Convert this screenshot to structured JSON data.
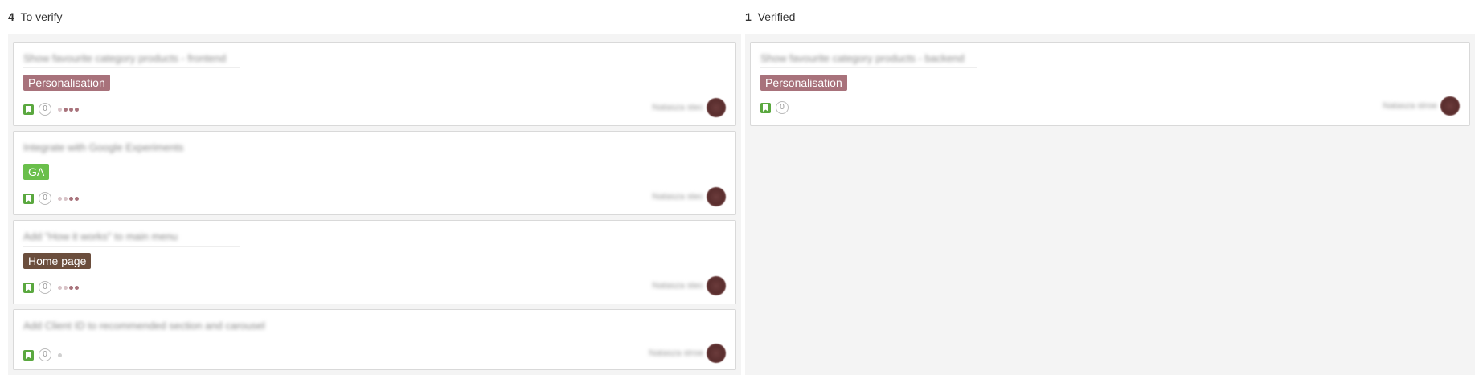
{
  "columns": [
    {
      "count": "4",
      "title": "To verify",
      "cards": [
        {
          "title": "Show favourite category products - frontend",
          "tag": "Personalisation",
          "comments": "0",
          "assignee": "Natasza stec"
        },
        {
          "title": "Integrate with Google Experiments",
          "tag": "GA",
          "comments": "0",
          "assignee": "Natasza stec"
        },
        {
          "title": "Add \"How it works\" to main menu",
          "tag": "Home page",
          "comments": "0",
          "assignee": "Natasza stec"
        },
        {
          "title": "Add Client ID to recommended section and carousel",
          "comments": "0",
          "assignee": "Natasza stroe"
        }
      ]
    },
    {
      "count": "1",
      "title": "Verified",
      "cards": [
        {
          "title": "Show favourite category products - backend",
          "tag": "Personalisation",
          "comments": "0",
          "assignee": "Natasza stroe"
        }
      ]
    }
  ],
  "colors": {
    "personalisation": "#a8727b",
    "ga": "#6abf4b",
    "home_page": "#6b4e3d",
    "column_bg": "#f4f4f4"
  },
  "icons": [
    "bookmark-icon",
    "comment-icon",
    "priority-dots-icon",
    "avatar"
  ]
}
